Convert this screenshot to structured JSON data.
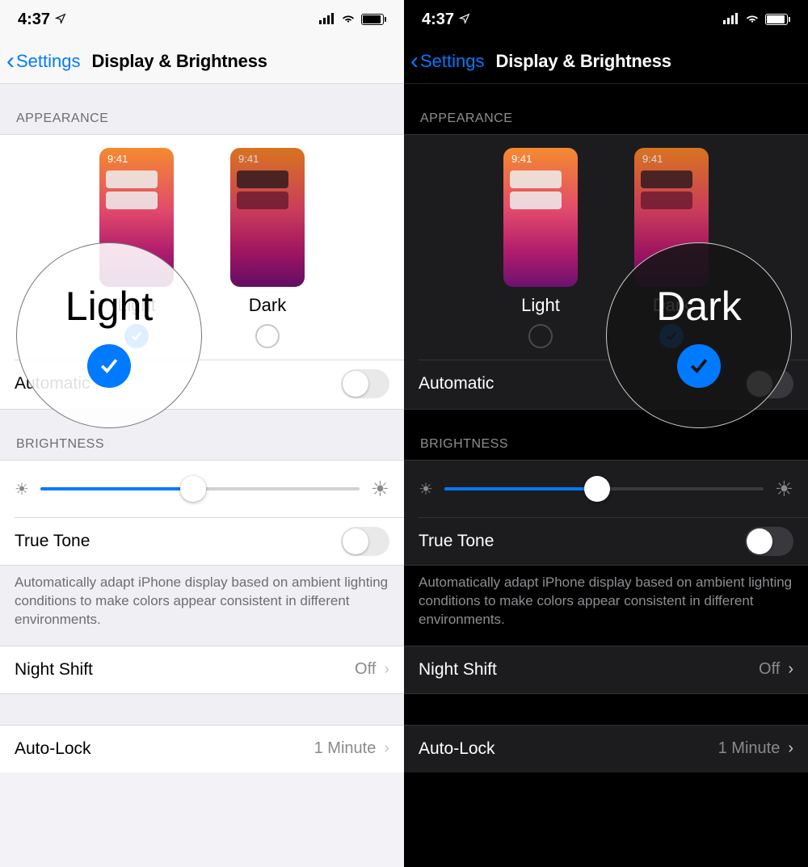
{
  "status": {
    "time": "4:37"
  },
  "nav": {
    "back": "Settings",
    "title": "Display & Brightness"
  },
  "sections": {
    "appearance": "APPEARANCE",
    "brightness": "BRIGHTNESS"
  },
  "appearance": {
    "preview_time": "9:41",
    "light_label": "Light",
    "dark_label": "Dark",
    "automatic_label": "Automatic"
  },
  "brightness": {
    "slider_percent": 48,
    "truetone_label": "True Tone",
    "truetone_footer": "Automatically adapt iPhone display based on ambient lighting conditions to make colors appear consistent in different environments."
  },
  "rows": {
    "night_shift": {
      "label": "Night Shift",
      "value": "Off"
    },
    "auto_lock": {
      "label": "Auto-Lock",
      "value": "1 Minute"
    }
  },
  "magnifier": {
    "light": "Light",
    "dark": "Dark"
  }
}
